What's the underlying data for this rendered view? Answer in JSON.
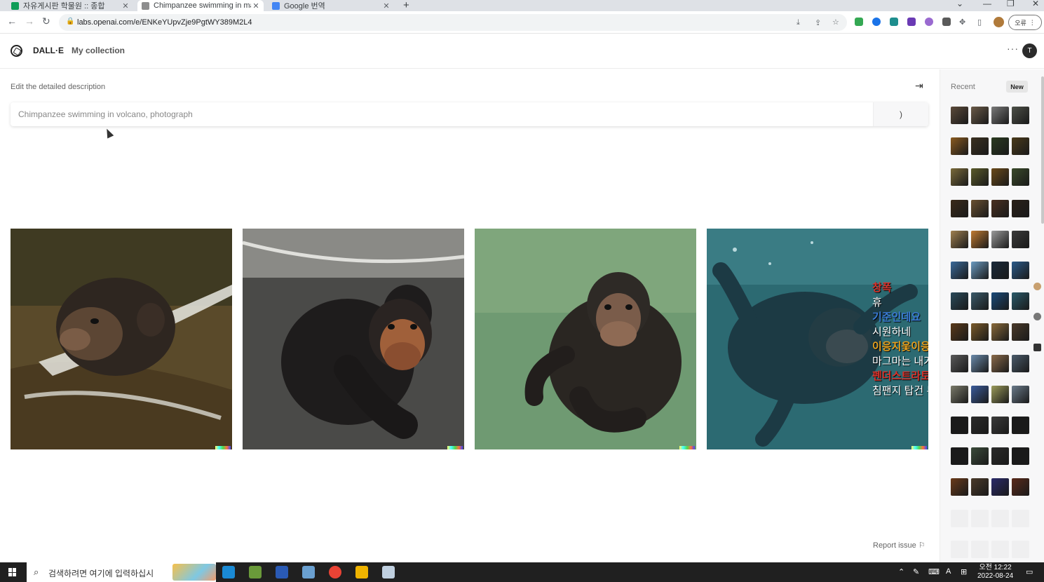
{
  "browser": {
    "tabs": [
      {
        "label": "자유게시판 학물원 :: 종합",
        "favicon_color": "#0f9d58"
      },
      {
        "label": "Chimpanzee swimming in magma",
        "favicon_color": "#8e8e8e"
      },
      {
        "label": "Google 번역",
        "favicon_color": "#4285f4"
      }
    ],
    "new_tab_label": "+",
    "url": "labs.openai.com/e/ENKeYUpvZje9PgtWY389M2L4",
    "profile_label": "오류"
  },
  "app": {
    "brand": "DALL·E",
    "nav_collection": "My collection",
    "avatar_initial": "T",
    "more_label": "···"
  },
  "editor": {
    "label": "Edit the detailed description",
    "prompt_value": "Chimpanzee swimming in volcano, photograph",
    "generate_label": ")",
    "collapse_icon": "collapse-right-icon"
  },
  "results": {
    "images": [
      {
        "name": "chimp-swimming-surface"
      },
      {
        "name": "chimp-swimming-dark-water"
      },
      {
        "name": "chimp-swimming-green-water"
      },
      {
        "name": "chimp-swimming-teal-water"
      }
    ],
    "overlay_chat": [
      {
        "user": "창폭",
        "message": "휴",
        "user_color": "#d8312a"
      },
      {
        "user": "기준인데요",
        "message": "시원하네",
        "user_color": "#3a7bd5"
      },
      {
        "user": "이응지웆이응지웆",
        "message": "마그마는 내가 먹으러",
        "user_color": "#e8a21f"
      },
      {
        "user": "펜더스트라토캐스터",
        "message": "침팬지 탑건 두가제",
        "user_color": "#d8312a"
      }
    ],
    "report_label": "Report issue"
  },
  "sidebar": {
    "recent_label": "Recent",
    "new_label": "New",
    "thumb_rows": [
      [
        "#5b4a3a",
        "#6a5a48",
        "#7a7a7a",
        "#4d5048"
      ],
      [
        "#8a5a20",
        "#3a3020",
        "#2a3a20",
        "#4a3a1a"
      ],
      [
        "#7a6a3a",
        "#5a5a2a",
        "#6a4a1a",
        "#3a4a2a"
      ],
      [
        "#3a2a1a",
        "#6a5030",
        "#4a3020",
        "#2a2018"
      ],
      [
        "#a08050",
        "#c07a30",
        "#9a9a9a",
        "#3a3a3a"
      ],
      [
        "#3a6a9a",
        "#6a9ac0",
        "#1a2a3a",
        "#2a5a8a"
      ],
      [
        "#2a4a5a",
        "#3a5a6a",
        "#1a4a7a",
        "#2a5a6a"
      ],
      [
        "#5a3a1a",
        "#7a5a2a",
        "#8a6a3a",
        "#4a3a2a"
      ],
      [
        "#5a5a5a",
        "#6a8aaa",
        "#8a6a4a",
        "#4a5a6a"
      ],
      [
        "#7a7a6a",
        "#3a5a9a",
        "#9a9a5a",
        "#6a7a8a"
      ],
      [
        "#1a1a1a",
        "#2a2a2a",
        "#3a3a3a",
        "#1a1a1a"
      ],
      [
        "#1a1a1a",
        "#3a4a3a",
        "#2a2a2a",
        "#1a1a1a"
      ],
      [
        "#6a3a1a",
        "#4a3a2a",
        "#2a2a6a",
        "#5a2a1a"
      ]
    ],
    "placeholder_rows": 2
  },
  "taskbar": {
    "search_placeholder": "검색하려면 여기에 입력하십시",
    "apps": [
      {
        "name": "edge-app",
        "color": "#1a8ad4"
      },
      {
        "name": "minecraft-app",
        "color": "#6a9a3a"
      },
      {
        "name": "vegas-app",
        "color": "#2a5ab4"
      },
      {
        "name": "editor-app",
        "color": "#6aa0d0"
      },
      {
        "name": "chrome-app",
        "color": "#ea4335"
      },
      {
        "name": "explorer-app",
        "color": "#f0b400"
      },
      {
        "name": "paint-app",
        "color": "#c0d0e0"
      }
    ],
    "clock_ampm_time": "오전 12:22",
    "clock_date": "2022-08-24",
    "input_mode": "A"
  }
}
